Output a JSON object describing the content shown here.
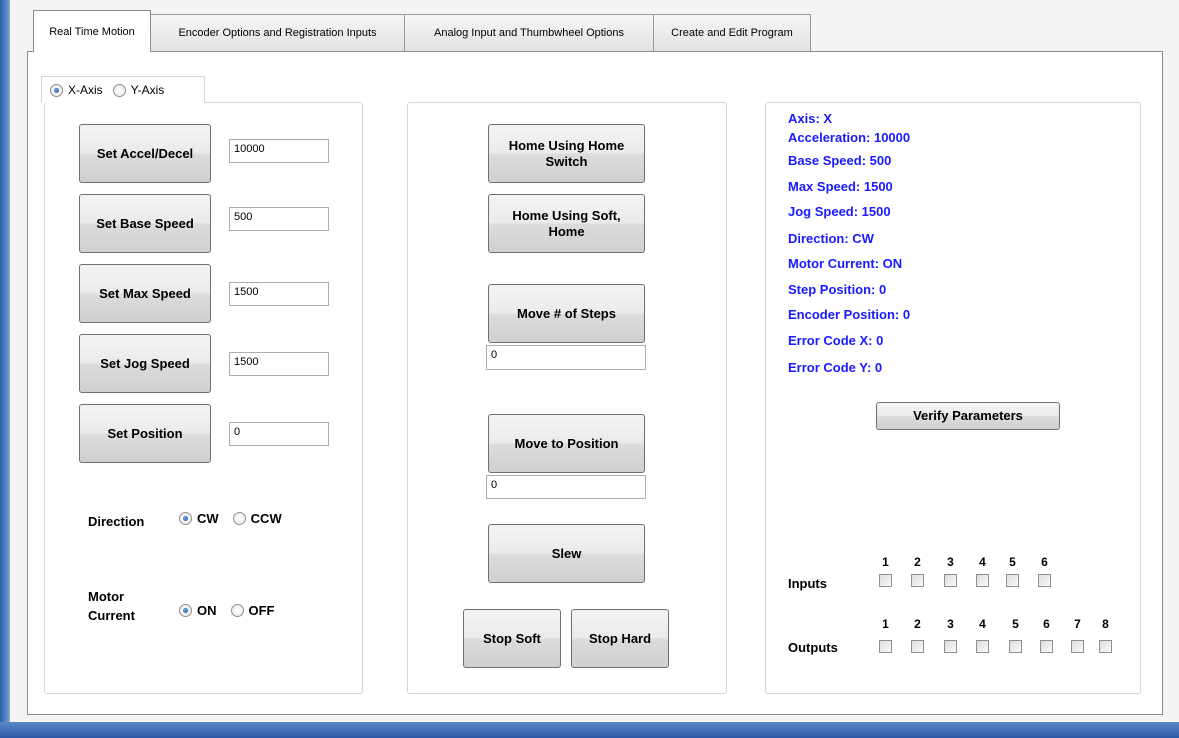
{
  "tabs": [
    {
      "label": "Real Time Motion"
    },
    {
      "label": "Encoder Options and Registration Inputs"
    },
    {
      "label": "Analog Input and Thumbwheel Options"
    },
    {
      "label": "Create and Edit Program"
    }
  ],
  "axis_select": {
    "x_label": "X-Axis",
    "y_label": "Y-Axis",
    "selected": "X-Axis"
  },
  "settings": {
    "accel_button": "Set Accel/Decel",
    "accel_value": "10000",
    "base_button": "Set Base Speed",
    "base_value": "500",
    "max_button": "Set Max Speed",
    "max_value": "1500",
    "jog_button": "Set Jog Speed",
    "jog_value": "1500",
    "position_button": "Set Position",
    "position_value": "0",
    "direction_label": "Direction",
    "cw_label": "CW",
    "ccw_label": "CCW",
    "motor_label_1": "Motor",
    "motor_label_2": "Current",
    "on_label": "ON",
    "off_label": "OFF"
  },
  "motion": {
    "home_switch_l1": "Home Using Home",
    "home_switch_l2": "Switch",
    "home_soft_l1": "Home Using Soft,",
    "home_soft_l2": "Home",
    "move_steps_button": "Move # of Steps",
    "move_steps_value": "0",
    "move_position_button": "Move to Position",
    "move_position_value": "0",
    "slew_button": "Slew",
    "stop_soft_button": "Stop Soft",
    "stop_hard_button": "Stop Hard"
  },
  "status": {
    "axis": "Axis: X",
    "acceleration": "Acceleration: 10000",
    "base_speed": "Base Speed: 500",
    "max_speed": "Max Speed: 1500",
    "jog_speed": "Jog Speed: 1500",
    "direction": "Direction: CW",
    "motor_current": "Motor Current: ON",
    "step_position": "Step Position: 0",
    "encoder_position": "Encoder Position: 0",
    "error_x": "Error Code X: 0",
    "error_y": "Error Code Y: 0",
    "verify_button": "Verify Parameters"
  },
  "io": {
    "inputs_label": "Inputs",
    "outputs_label": "Outputs",
    "input_numbers": [
      "1",
      "2",
      "3",
      "4",
      "5",
      "6"
    ],
    "output_numbers": [
      "1",
      "2",
      "3",
      "4",
      "5",
      "6",
      "7",
      "8"
    ]
  },
  "colors": {
    "status_text": "#1a1aff",
    "window_frame": "#2d5fa8"
  }
}
